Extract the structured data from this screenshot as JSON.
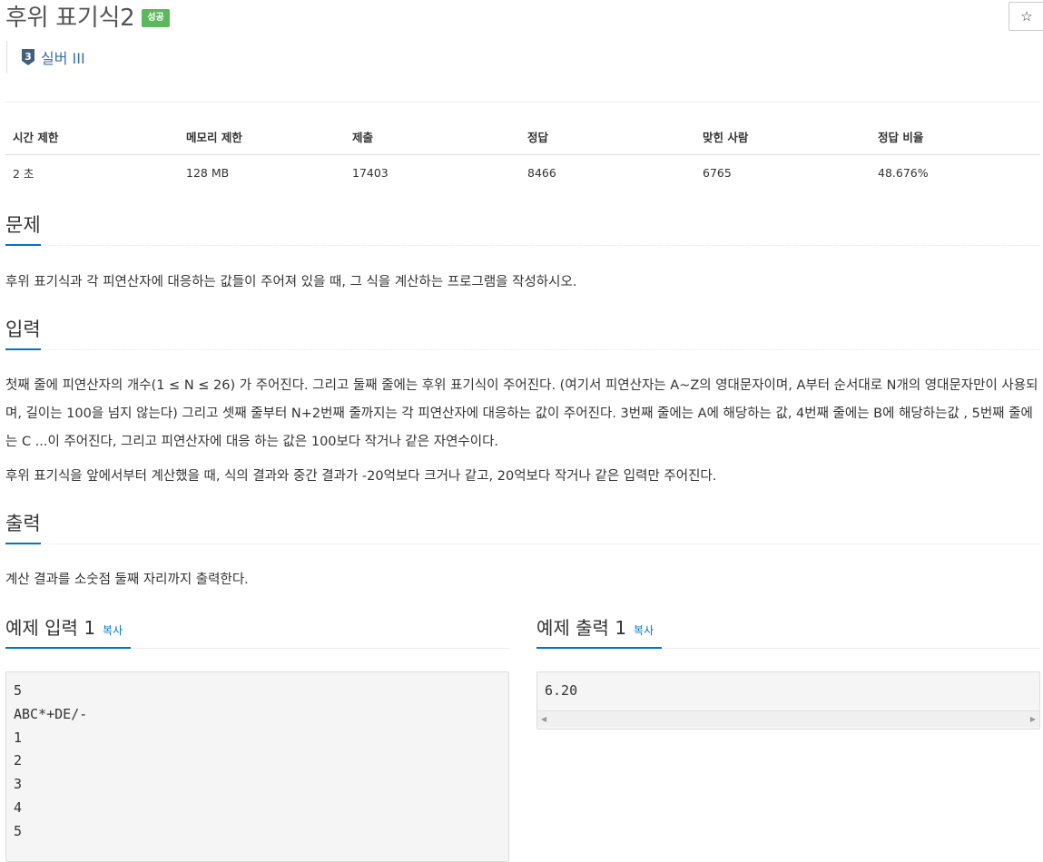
{
  "problem": {
    "title": "후위 표기식2",
    "status_badge": "성공",
    "star_icon": "☆",
    "tier": {
      "number": "3",
      "label": "실버 III",
      "color": "#435f7a"
    }
  },
  "info_table": {
    "headers": [
      "시간 제한",
      "메모리 제한",
      "제출",
      "정답",
      "맞힌 사람",
      "정답 비율"
    ],
    "values": [
      "2 초",
      "128 MB",
      "17403",
      "8466",
      "6765",
      "48.676%"
    ]
  },
  "sections": {
    "description": {
      "title": "문제",
      "text": "후위 표기식과 각 피연산자에 대응하는 값들이 주어져 있을 때, 그 식을 계산하는 프로그램을 작성하시오."
    },
    "input": {
      "title": "입력",
      "para1": "첫째 줄에 피연산자의 개수(1 ≤ N ≤ 26) 가 주어진다. 그리고 둘째 줄에는 후위 표기식이 주어진다. (여기서 피연산자는 A~Z의 영대문자이며, A부터 순서대로 N개의 영대문자만이 사용되며, 길이는 100을 넘지 않는다) 그리고 셋째 줄부터 N+2번째 줄까지는 각 피연산자에 대응하는 값이 주어진다. 3번째 줄에는 A에 해당하는 값, 4번째 줄에는 B에 해당하는값 , 5번째 줄에는 C ...이 주어진다, 그리고 피연산자에 대응 하는 값은 100보다 작거나 같은 자연수이다.",
      "para2": "후위 표기식을 앞에서부터 계산했을 때, 식의 결과와 중간 결과가 -20억보다 크거나 같고, 20억보다 작거나 같은 입력만 주어진다."
    },
    "output": {
      "title": "출력",
      "text": "계산 결과를 소숫점 둘째 자리까지 출력한다."
    }
  },
  "samples": {
    "input_title": "예제 입력 1",
    "output_title": "예제 출력 1",
    "copy_label": "복사",
    "input_text": "5\nABC*+DE/-\n1\n2\n3\n4\n5",
    "output_text": "6.20"
  },
  "colors": {
    "accent": "#0076c0",
    "success": "#5cb85c"
  }
}
